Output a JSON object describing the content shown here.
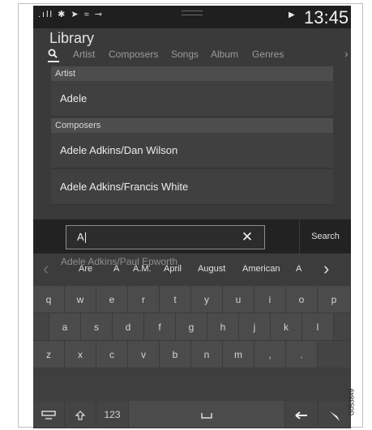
{
  "status_bar": {
    "time": "13:45"
  },
  "library": {
    "title": "Library",
    "tabs": [
      "Artist",
      "Composers",
      "Songs",
      "Album",
      "Genres"
    ]
  },
  "results": {
    "artist_header": "Artist",
    "artist_rows": [
      "Adele"
    ],
    "composers_header": "Composers",
    "composer_rows": [
      "Adele Adkins/Dan Wilson",
      "Adele Adkins/Francis White",
      "Adele Adkins/Paul Epworth"
    ]
  },
  "search": {
    "value": "A",
    "clear_label": "✕",
    "button_label": "Search"
  },
  "suggestions": [
    "Are",
    "A",
    "A.M.",
    "April",
    "August",
    "American",
    "A"
  ],
  "keyboard": {
    "row1": [
      "q",
      "w",
      "e",
      "r",
      "t",
      "y",
      "u",
      "i",
      "o",
      "p"
    ],
    "row2": [
      "a",
      "s",
      "d",
      "f",
      "g",
      "h",
      "j",
      "k",
      "l"
    ],
    "row3": [
      "z",
      "x",
      "c",
      "v",
      "b",
      "n",
      "m",
      ",",
      "."
    ],
    "numbers_label": "123"
  },
  "figure_code": "G053849",
  "icons": [
    "signal-icon",
    "bluetooth-icon",
    "location-icon",
    "wifi-icon",
    "usb-icon",
    "play-icon",
    "search-icon",
    "chevron-right-icon",
    "shift-icon",
    "space-icon",
    "backspace-icon",
    "hide-keyboard-icon",
    "handwriting-icon"
  ]
}
